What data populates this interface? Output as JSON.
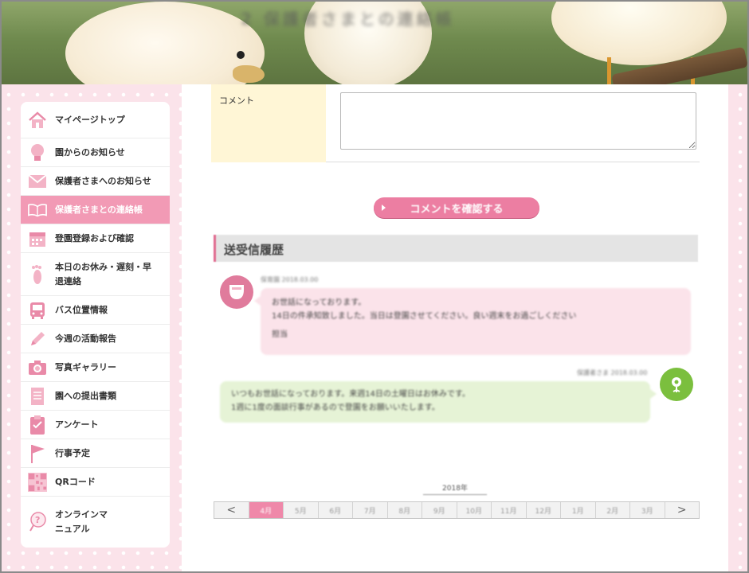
{
  "header": {
    "title": "2 保護者さまとの連絡帳"
  },
  "sidebar": {
    "items": [
      {
        "label": "マイページトップ",
        "icon": "home-icon"
      },
      {
        "label": "園からのお知らせ",
        "icon": "lightbulb-icon"
      },
      {
        "label": "保護者さまへのお知らせ",
        "icon": "envelope-icon"
      },
      {
        "label": "保護者さまとの連絡帳",
        "icon": "book-icon",
        "active": true
      },
      {
        "label": "登園登録および確認",
        "icon": "calendar-icon"
      },
      {
        "label": "本日のお休み・遅刻・早退連絡",
        "icon": "footprint-icon"
      },
      {
        "label": "バス位置情報",
        "icon": "bus-icon"
      },
      {
        "label": "今週の活動報告",
        "icon": "pencil-icon"
      },
      {
        "label": "写真ギャラリー",
        "icon": "camera-icon"
      },
      {
        "label": "園への提出書類",
        "icon": "document-icon"
      },
      {
        "label": "アンケート",
        "icon": "clipboard-icon"
      },
      {
        "label": "行事予定",
        "icon": "flag-icon"
      },
      {
        "label": "QRコード",
        "icon": "qr-code-icon"
      },
      {
        "label": "オンラインマニュアル",
        "icon": "help-icon"
      }
    ]
  },
  "comment_form": {
    "label": "コメント",
    "value": "",
    "submit_label": "コメントを確認する"
  },
  "history": {
    "title": "送受信履歴",
    "messages": [
      {
        "side": "left",
        "meta": "保育園 2018.03.00",
        "lines": [
          "お世話になっております。",
          "14日の件承知致しました。当日は登園させてください。良い週末をお過ごしください",
          "担当"
        ]
      },
      {
        "side": "right",
        "meta": "保護者さま 2018.03.00",
        "lines": [
          "いつもお世話になっております。来週14日の土曜日はお休みです。",
          "1週に1度の面談行事があるので登園をお願いいたします。"
        ]
      }
    ]
  },
  "pager": {
    "year": "2018年",
    "prev": "<",
    "next": ">",
    "months": [
      "4月",
      "5月",
      "6月",
      "7月",
      "8月",
      "9月",
      "10月",
      "11月",
      "12月",
      "1月",
      "2月",
      "3月"
    ],
    "selected_index": 0
  },
  "colors": {
    "accent_pink": "#ec7ea2",
    "sidebar_active": "#f29ab5",
    "label_bg": "#fff6d6",
    "bubble_pink": "#fbe3ea",
    "bubble_green": "#e6f3d6"
  }
}
